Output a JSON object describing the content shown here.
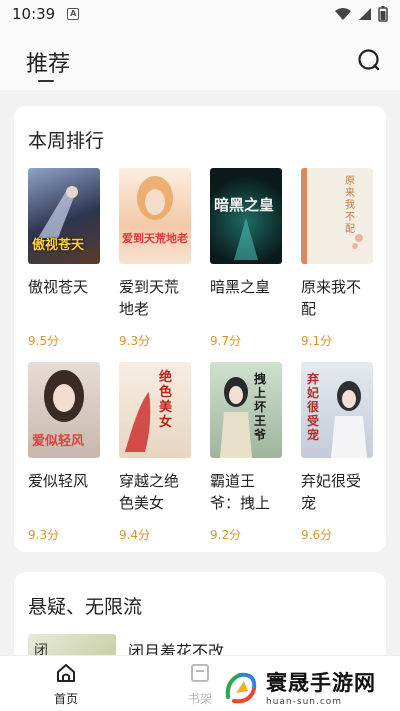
{
  "status_bar": {
    "time": "10:39",
    "notif_glyph": "A"
  },
  "header": {
    "title": "推荐"
  },
  "rank_section": {
    "title": "本周排行",
    "books": [
      {
        "title": "傲视苍天",
        "score": "9.5分",
        "cover_text": "傲视苍天",
        "cover_color": "#3d4a66"
      },
      {
        "title": "爱到天荒地老",
        "score": "9.3分",
        "cover_text": "爱到天荒地老",
        "cover_color": "#f3d6c3"
      },
      {
        "title": "暗黑之皇",
        "score": "9.7分",
        "cover_text": "暗黑之皇",
        "cover_color": "#0d1b1f"
      },
      {
        "title": "原来我不配",
        "score": "9.1分",
        "cover_text": "原来我不配",
        "cover_color": "#f1e9de"
      },
      {
        "title": "爱似轻风",
        "score": "9.3分",
        "cover_text": "爱似轻风",
        "cover_color": "#d9cfc9"
      },
      {
        "title": "穿越之绝色美女",
        "score": "9.4分",
        "cover_text": "绝色美女",
        "cover_color": "#f0e6d8"
      },
      {
        "title": "霸道王爷：拽上",
        "score": "9.2分",
        "cover_text": "拽上坏王爷",
        "cover_color": "#b9ccb7"
      },
      {
        "title": "弃妃很受宠",
        "score": "9.6分",
        "cover_text": "弃妃很受宠",
        "cover_color": "#d8dde6"
      }
    ]
  },
  "suspense_section": {
    "title": "悬疑、无限流",
    "first_item": {
      "title": "闭月羞花不改",
      "thumb_text": "闭"
    }
  },
  "bottom_nav": {
    "home_label": "首页",
    "shelf_label": "书架"
  },
  "watermark": {
    "name": "寰晟手游网",
    "url": "huan-sun.com"
  }
}
